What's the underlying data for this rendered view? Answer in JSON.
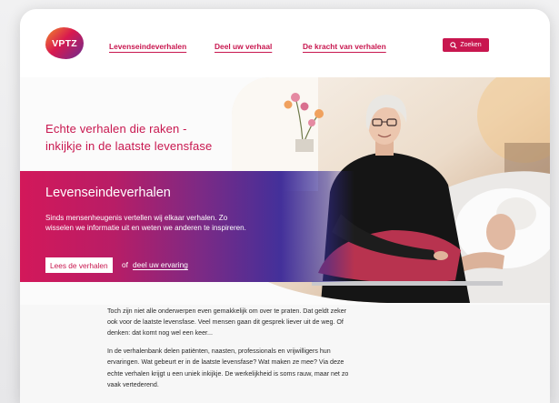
{
  "header": {
    "logo": {
      "text": "VPTZ"
    },
    "nav": [
      {
        "label": "Levenseindeverhalen"
      },
      {
        "label": "Deel uw verhaal"
      },
      {
        "label": "De kracht van verhalen"
      }
    ],
    "search": {
      "label": "Zoeken",
      "icon": "search-icon"
    }
  },
  "hero": {
    "title_line1": "Echte verhalen die raken -",
    "title_line2": "inkijkje in de laatste levensfase"
  },
  "band": {
    "heading": "Levenseindeverhalen",
    "text": "Sinds mensenheugenis vertellen wij elkaar verhalen. Zo wisselen we informatie uit en weten we anderen te inspireren.",
    "cta_label": "Lees de verhalen",
    "or_text": "of",
    "link_label": "deel uw ervaring"
  },
  "intro": {
    "paragraphs": [
      "Toch zijn niet alle onderwerpen even gemakkelijk om over te praten. Dat geldt zeker ook voor de laatste levensfase. Veel mensen gaan dit gesprek liever uit de weg. Of denken: dat komt nog wel een keer...",
      "In de verhalenbank delen patiënten, naasten, professionals en vrijwilligers hun ervaringen. Wat gebeurt er in de laatste levensfase? Wat maken ze mee? Via deze echte verhalen krijgt u een uniek inkijkje. De werkelijkheid is soms rauw, maar net zo vaak vertederend."
    ]
  },
  "colors": {
    "brand": "#c8174f",
    "band_start": "#d3185a",
    "band_end": "#43309a",
    "page_background": "#ececed"
  }
}
